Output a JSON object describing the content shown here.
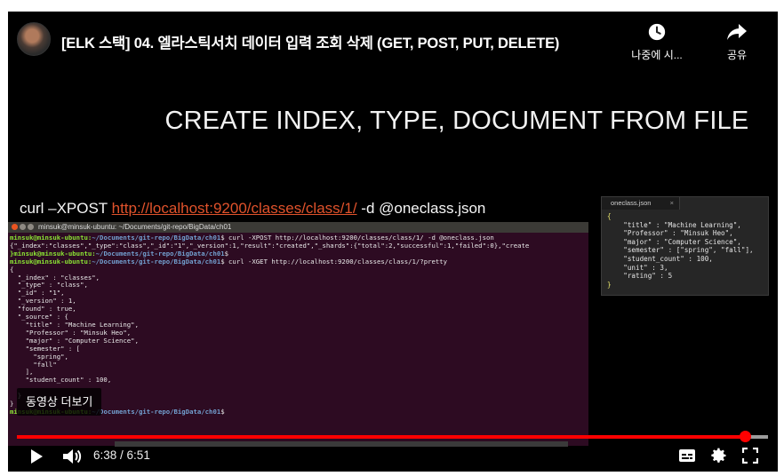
{
  "video": {
    "title": "[ELK 스택] 04. 엘라스틱서치 데이터 입력 조회 삭제 (GET, POST, PUT, DELETE)",
    "watch_later_label": "나중에 시...",
    "share_label": "공유",
    "more_videos_label": "동영상 더보기",
    "current_time": "6:38",
    "duration": "6:51",
    "progress": 0.969
  },
  "slide": {
    "heading": "CREATE INDEX, TYPE, DOCUMENT FROM FILE",
    "curl_prefix": "curl –XPOST ",
    "curl_url": "http://localhost:9200/classes/class/1/",
    "curl_suffix": " -d @oneclass.json"
  },
  "terminal": {
    "title": "minsuk@minsuk-ubuntu: ~/Documents/git-repo/BigData/ch01",
    "lines": [
      {
        "prompt": "minsuk@minsuk-ubuntu:",
        "path": "~/Documents/git-repo/BigData/ch01",
        "cmd": "$ curl -XPOST http://localhost:9200/classes/class/1/ -d @oneclass.json"
      },
      {
        "text": "{\"_index\":\"classes\",\"_type\":\"class\",\"_id\":\"1\",\"_version\":1,\"result\":\"created\",\"_shards\":{\"total\":2,\"successful\":1,\"failed\":0},\"create"
      },
      {
        "prompt": "}minsuk@minsuk-ubuntu:",
        "path": "~/Documents/git-repo/BigData/ch01",
        "cmd": "$"
      },
      {
        "prompt": "minsuk@minsuk-ubuntu:",
        "path": "~/Documents/git-repo/BigData/ch01",
        "cmd": "$ curl -XGET http://localhost:9200/classes/class/1/?pretty"
      },
      {
        "text": "{"
      },
      {
        "text": "  \"_index\" : \"classes\","
      },
      {
        "text": "  \"_type\" : \"class\","
      },
      {
        "text": "  \"_id\" : \"1\","
      },
      {
        "text": "  \"_version\" : 1,"
      },
      {
        "text": "  \"found\" : true,"
      },
      {
        "text": "  \"_source\" : {"
      },
      {
        "text": "    \"title\" : \"Machine Learning\","
      },
      {
        "text": "    \"Professor\" : \"Minsuk Heo\","
      },
      {
        "text": "    \"major\" : \"Computer Science\","
      },
      {
        "text": "    \"semester\" : ["
      },
      {
        "text": "      \"spring\","
      },
      {
        "text": "      \"fall\""
      },
      {
        "text": "    ],"
      },
      {
        "text": "    \"student_count\" : 100,"
      },
      {
        "text": ""
      },
      {
        "text": "  }"
      },
      {
        "text": "}"
      },
      {
        "prompt": "minsuk@minsuk-ubuntu:",
        "path": "~/Documents/git-repo/BigData/ch01",
        "cmd": "$"
      }
    ]
  },
  "json_file": {
    "tab_label": "oneclass.json",
    "tab_close": "×",
    "lines": [
      "{",
      "    \"title\" : \"Machine Learning\",",
      "    \"Professor\" : \"Minsuk Heo\",",
      "    \"major\" : \"Computer Science\",",
      "    \"semester\" : [\"spring\", \"fall\"],",
      "    \"student_count\" : 100,",
      "    \"unit\" : 3,",
      "    \"rating\" : 5",
      "}"
    ]
  },
  "colors": {
    "accent": "#ff0000",
    "url": "#e0522b",
    "terminal_bg": "#2d0b22",
    "prompt": "#8ae234",
    "path": "#729fcf"
  },
  "icons": {
    "watch_later": "clock-icon",
    "share": "share-arrow-icon",
    "play": "play-icon",
    "volume": "volume-icon",
    "captions": "subtitles-icon",
    "settings": "gear-icon",
    "fullscreen": "fullscreen-icon"
  }
}
